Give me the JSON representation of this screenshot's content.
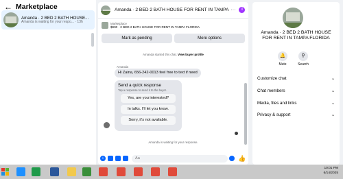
{
  "left": {
    "title": "Marketplace",
    "conversation": {
      "name": "Amanda · 2 BED 2 BATH HOUSE...",
      "preview": "Amanda is waiting for your respo... · 13h"
    }
  },
  "chat": {
    "header_title": "Amanda · 2 BED 2 BATH HOUSE FOR RENT IN TAMPA",
    "header_more": "···",
    "listing_category": "Marketplace",
    "listing_price": "$900 · 2 BED 2 BATH HOUSE FOR RENT IN TAMPA FLORIDA",
    "mark_pending": "Mark as pending",
    "more_options": "More options",
    "started_text": "Amanda started this chat.",
    "view_profile": "View buyer profile",
    "sender": "Amanda",
    "message": "Hi Zaina, 656-242-0013 feel free to text if need",
    "quick_title": "Send a quick response",
    "quick_sub": "Tap a response to send it to the buyer.",
    "quick_replies": [
      "Yes, are you interested?",
      "In talks. I'll let you know.",
      "Sorry, it's not available."
    ],
    "waiting_text": "Amanda is waiting for your response.",
    "input_placeholder": "Aa"
  },
  "right": {
    "title": "Amanda · 2 BED 2 BATH HOUSE FOR RENT IN TAMPA FLORIDA",
    "mute": "Mute",
    "search": "Search",
    "items": [
      "Customize chat",
      "Chat members",
      "Media, files and links",
      "Privacy & support"
    ]
  },
  "taskbar": {
    "time": "10:01 PM",
    "date": "6/14/2025"
  },
  "colors": {
    "accent": "#0866ff",
    "info": "#a033ff",
    "selected": "#e7f3ff"
  }
}
